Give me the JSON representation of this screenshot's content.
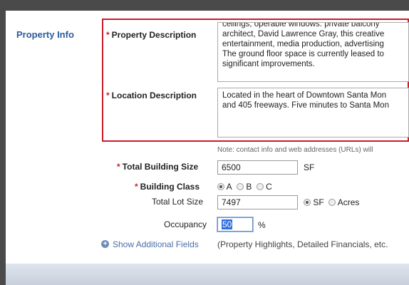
{
  "section": {
    "title": "Property Info"
  },
  "property_description": {
    "required_mark": "*",
    "label": "Property Description",
    "lines": [
      "ceilings, operable windows. private balcony",
      "architect, David Lawrence Gray, this creative",
      "entertainment, media production, advertising",
      "The ground floor space is currently leased to",
      "significant improvements."
    ]
  },
  "location_description": {
    "required_mark": "*",
    "label": "Location Description",
    "lines": [
      "Located in the heart of Downtown Santa Mon",
      "and 405 freeways. Five minutes to Santa Mon"
    ]
  },
  "note": "Note: contact info and web addresses (URLs) will",
  "total_building_size": {
    "required_mark": "*",
    "label": "Total Building Size",
    "value": "6500",
    "unit": "SF"
  },
  "building_class": {
    "required_mark": "*",
    "label": "Building Class",
    "options": [
      "A",
      "B",
      "C"
    ],
    "selected": "A"
  },
  "total_lot_size": {
    "label": "Total Lot Size",
    "value": "7497",
    "units": [
      "SF",
      "Acres"
    ],
    "selected_unit": "SF"
  },
  "occupancy": {
    "label": "Occupancy",
    "value": "50",
    "unit": "%"
  },
  "additional_fields": {
    "link": "Show Additional Fields",
    "hint": "(Property Highlights, Detailed Financials, etc."
  }
}
